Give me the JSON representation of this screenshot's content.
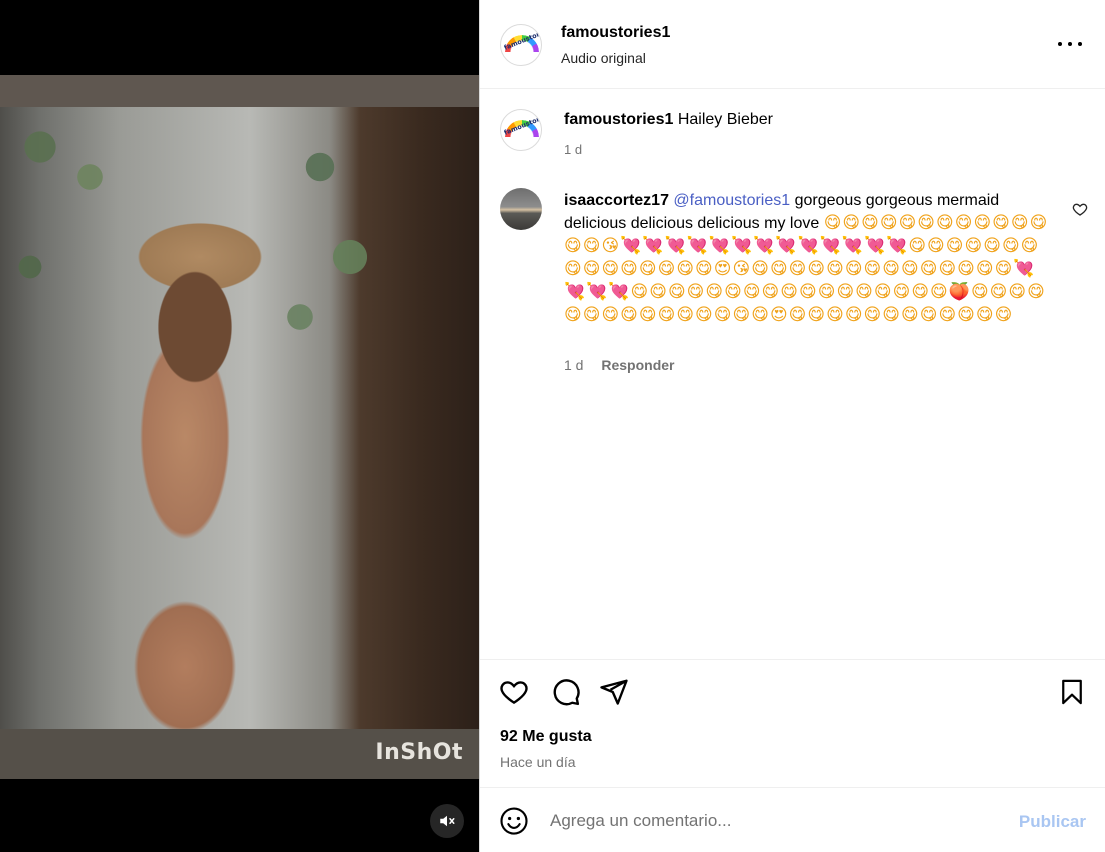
{
  "media": {
    "watermark": "InShOt",
    "mute_icon": "speaker-muted-icon"
  },
  "post_header": {
    "username": "famoustories1",
    "audio": "Audio original",
    "avatar_text": "famoustories",
    "more_icon": "more-options-icon"
  },
  "caption": {
    "username": "famoustories1",
    "text": "Hailey Bieber",
    "time": "1 d"
  },
  "comment": {
    "username": "isaaccortez17",
    "mention": "@famoustories1",
    "text": "gorgeous gorgeous mermaid delicious delicious delicious my love",
    "emojis": "😋😋😋😋😋😋😋😋😋😋😋😋😋😋😘💘💘💘💘💘💘💘💘💘💘💘💘💘😋😋😋😋😋😋😋😋😋😋😋😋😋😋😋😍😘😋😋😋😋😋😋😋😋😋😋😋😋😋😋💘💘💘💘😋😋😋😋😋😋😋😋😋😋😋😋😋😋😋😋😋🍑😋😋😋😋😋😋😋😋😋😋😋😋😋😋😋😍😋😋😋😋😋😋😋😋😋😋😋😋",
    "time": "1 d",
    "reply_label": "Responder"
  },
  "actions": {
    "likes": "92 Me gusta",
    "ago": "Hace un día"
  },
  "composer": {
    "placeholder": "Agrega un comentario...",
    "publish_label": "Publicar"
  },
  "colors": {
    "mention": "#4a5fc4",
    "publish_disabled": "#a9c6f2",
    "secondary_text": "#737373"
  }
}
